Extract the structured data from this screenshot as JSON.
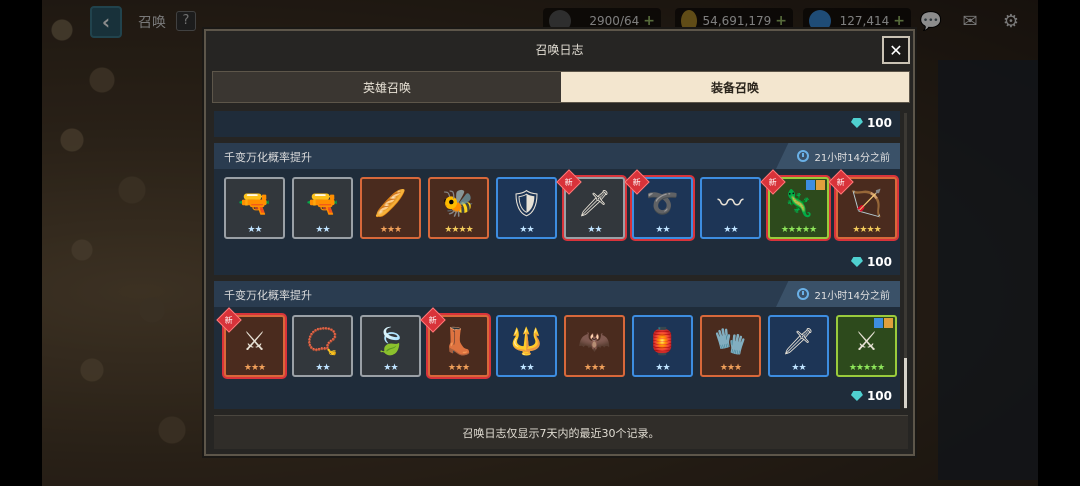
{
  "topbar": {
    "back_icon": "chevron-left-icon",
    "title": "召唤",
    "help": "?",
    "resources": [
      {
        "name": "stamina",
        "icon": "stamina-icon",
        "value": "2900/64"
      },
      {
        "name": "gold",
        "icon": "coin-icon",
        "value": "54,691,179"
      },
      {
        "name": "gem",
        "icon": "gem-icon",
        "value": "127,414"
      }
    ]
  },
  "modal": {
    "title": "召唤日志",
    "close": "✕",
    "tabs": [
      {
        "label": "英雄召唤",
        "active": false
      },
      {
        "label": "装备召唤",
        "active": true
      }
    ],
    "top_cost": "100",
    "entries": [
      {
        "title": "千变万化概率提升",
        "time": "21小时14分之前",
        "cost": "100",
        "items": [
          {
            "icon": "shotgun-icon",
            "art": "🔫",
            "rarity": "common",
            "stars": "★★",
            "new": false
          },
          {
            "icon": "rifle-icon",
            "art": "🔫",
            "rarity": "common",
            "stars": "★★",
            "new": false
          },
          {
            "icon": "claw-icon",
            "art": "🥖",
            "rarity": "epic",
            "stars": "★★★",
            "new": false
          },
          {
            "icon": "amulet-icon",
            "art": "🐝",
            "rarity": "epic",
            "stars": "★★★★",
            "new": false
          },
          {
            "icon": "shield-icon",
            "art": "🛡",
            "rarity": "rare",
            "stars": "★★",
            "new": false
          },
          {
            "icon": "dagger-icon",
            "art": "🗡",
            "rarity": "common",
            "stars": "★★",
            "new": true
          },
          {
            "icon": "seahorse-icon",
            "art": "➰",
            "rarity": "rare",
            "stars": "★★",
            "new": true
          },
          {
            "icon": "whip-icon",
            "art": "〰",
            "rarity": "rare",
            "stars": "★★",
            "new": false
          },
          {
            "icon": "figure-icon",
            "art": "🦎",
            "rarity": "legend",
            "stars": "★★★★★",
            "new": true
          },
          {
            "icon": "bow-icon",
            "art": "🏹",
            "rarity": "epic",
            "stars": "★★★★",
            "new": true
          }
        ]
      },
      {
        "title": "千变万化概率提升",
        "time": "21小时14分之前",
        "cost": "100",
        "items": [
          {
            "icon": "staff-icon",
            "art": "⚔",
            "rarity": "epic",
            "stars": "★★★",
            "new": true
          },
          {
            "icon": "necklace-icon",
            "art": "📿",
            "rarity": "common",
            "stars": "★★",
            "new": false
          },
          {
            "icon": "leaf-icon",
            "art": "🍃",
            "rarity": "common",
            "stars": "★★",
            "new": false
          },
          {
            "icon": "boot-icon",
            "art": "👢",
            "rarity": "epic",
            "stars": "★★★",
            "new": true
          },
          {
            "icon": "spear-icon",
            "art": "🔱",
            "rarity": "rare",
            "stars": "★★",
            "new": false
          },
          {
            "icon": "wings-icon",
            "art": "🦇",
            "rarity": "epic",
            "stars": "★★★",
            "new": false
          },
          {
            "icon": "lantern-icon",
            "art": "🏮",
            "rarity": "rare",
            "stars": "★★",
            "new": false
          },
          {
            "icon": "gauntlet-icon",
            "art": "🧤",
            "rarity": "epic",
            "stars": "★★★",
            "new": false
          },
          {
            "icon": "sword-icon",
            "art": "🗡",
            "rarity": "rare",
            "stars": "★★",
            "new": false
          },
          {
            "icon": "greatsword-icon",
            "art": "⚔",
            "rarity": "legend",
            "stars": "★★★★★",
            "new": false
          }
        ]
      }
    ],
    "footer": "召唤日志仅显示7天内的最近30个记录。"
  },
  "badges": {
    "new": "新"
  },
  "colors": {
    "legend": "#9acb3c",
    "epic": "#d8683a",
    "rare": "#3d8de0",
    "common": "#9aa0a6",
    "new": "#d8333a"
  }
}
